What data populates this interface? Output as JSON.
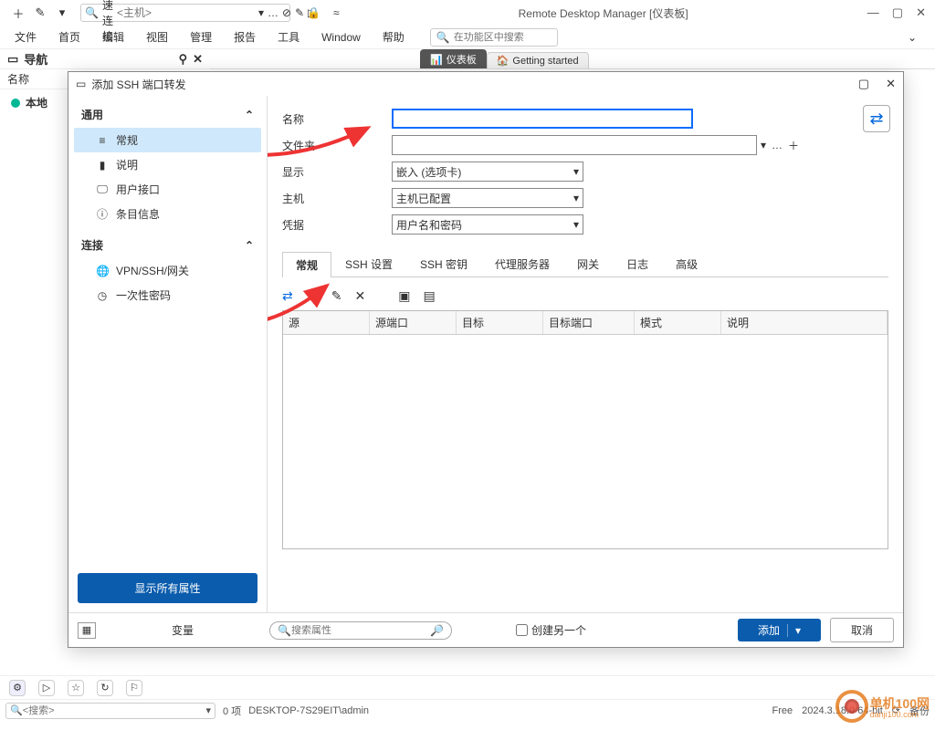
{
  "app": {
    "title": "Remote Desktop Manager [仪表板]",
    "quick_connect_label": "快速连接",
    "quick_connect_placeholder": "<主机>"
  },
  "menu": {
    "file": "文件",
    "home": "首页",
    "edit": "编辑",
    "view": "视图",
    "manage": "管理",
    "report": "报告",
    "tools": "工具",
    "window": "Window",
    "help": "帮助",
    "ribbon_search_placeholder": "在功能区中搜索"
  },
  "docs": {
    "tab_dashboard": "仪表板",
    "tab_getting": "Getting started"
  },
  "nav": {
    "title": "导航",
    "col_name": "名称",
    "item_local": "本地"
  },
  "dialog": {
    "title": "添加 SSH 端口转发",
    "side_group_general": "通用",
    "side_general": "常规",
    "side_desc": "说明",
    "side_ui": "用户接口",
    "side_entry": "条目信息",
    "side_group_conn": "连接",
    "side_vpn": "VPN/SSH/网关",
    "side_otp": "一次性密码",
    "show_all": "显示所有属性",
    "lbl_name": "名称",
    "lbl_folder": "文件夹",
    "lbl_display": "显示",
    "lbl_host": "主机",
    "lbl_cred": "凭据",
    "val_display": "嵌入 (选项卡)",
    "val_host": "主机已配置",
    "val_cred": "用户名和密码",
    "tab_general": "常规",
    "tab_ssh_settings": "SSH 设置",
    "tab_ssh_key": "SSH 密钥",
    "tab_proxy": "代理服务器",
    "tab_gateway": "网关",
    "tab_log": "日志",
    "tab_adv": "高级",
    "grid_source": "源",
    "grid_sport": "源端口",
    "grid_target": "目标",
    "grid_tport": "目标端口",
    "grid_mode": "模式",
    "grid_desc": "说明",
    "footer_var": "变量",
    "footer_search": "搜索属性",
    "footer_create_another": "创建另一个",
    "footer_add": "添加",
    "footer_cancel": "取消"
  },
  "status": {
    "search_placeholder": "<搜索>",
    "items": "0 项",
    "host": "DESKTOP-7S29EIT\\admin",
    "license": "Free",
    "version": "2024.3.18.0 64-bit",
    "backup": "备份"
  },
  "watermark": {
    "text": "单机100网",
    "sub": "danji100.com"
  }
}
